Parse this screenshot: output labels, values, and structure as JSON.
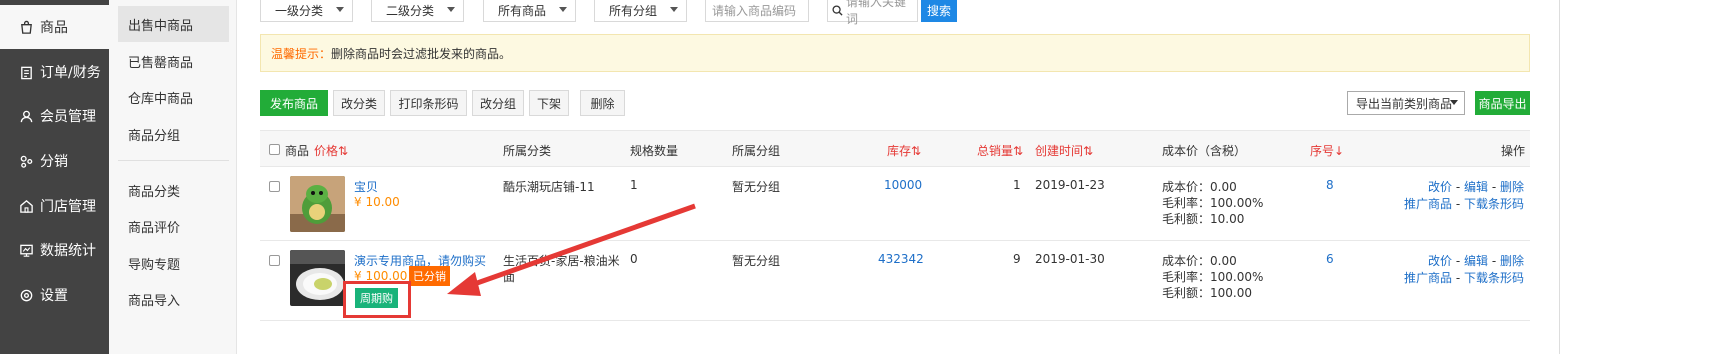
{
  "nav": {
    "items": [
      {
        "label": "商品",
        "icon": "bag-icon"
      },
      {
        "label": "订单/财务",
        "icon": "clipboard-icon"
      },
      {
        "label": "会员管理",
        "icon": "user-icon"
      },
      {
        "label": "分销",
        "icon": "share-icon"
      },
      {
        "label": "门店管理",
        "icon": "store-icon"
      },
      {
        "label": "数据统计",
        "icon": "monitor-icon"
      },
      {
        "label": "设置",
        "icon": "gear-icon"
      }
    ]
  },
  "subnav": {
    "items": [
      "出售中商品",
      "已售罄商品",
      "仓库中商品",
      "商品分组",
      "商品分类",
      "商品评价",
      "导购专题",
      "商品导入"
    ]
  },
  "filters": {
    "category1": "一级分类",
    "category2": "二级分类",
    "all_goods": "所有商品",
    "all_groups": "所有分组",
    "code_placeholder": "请输入商品编码",
    "keyword_placeholder": "请输入关键词",
    "search_label": "搜索"
  },
  "notice": {
    "lead": "温馨提示：",
    "text": "删除商品时会过滤批发来的商品。"
  },
  "toolbar": {
    "publish": "发布商品",
    "change_category": "改分类",
    "print_barcode": "打印条形码",
    "change_group": "改分组",
    "unlist": "下架",
    "delete": "删除",
    "export_select": "导出当前类别商品",
    "export_button": "商品导出"
  },
  "table": {
    "headers": {
      "goods": "商品",
      "price": "价格⇅",
      "category": "所属分类",
      "spec_count": "规格数量",
      "group": "所属分组",
      "stock": "库存⇅",
      "sales": "总销量⇅",
      "created": "创建时间⇅",
      "cost": "成本价（含税）",
      "seq": "序号↓",
      "ops": "操作"
    },
    "rows": [
      {
        "name": "宝贝",
        "price": "¥ 10.00",
        "category": "酷乐潮玩店铺-11",
        "spec_count": "1",
        "group": "暂无分组",
        "stock": "10000",
        "sales": "1",
        "created": "2019-01-23",
        "cost_lines": [
          "成本价：0.00",
          "毛利率：100.00%",
          "毛利额：10.00"
        ],
        "seq": "8",
        "ops_line1": [
          "改价",
          "编辑",
          "删除"
        ],
        "ops_line2": [
          "推广商品",
          "下载条形码"
        ]
      },
      {
        "name": "演示专用商品，请勿购买",
        "price": "¥ 100.00",
        "tag_distribution": "已分销",
        "tag_period": "周期购",
        "category_line1": "生活百货-家居-粮油米",
        "category_line2": "面",
        "spec_count": "0",
        "group": "暂无分组",
        "stock": "432342",
        "sales": "9",
        "created": "2019-01-30",
        "cost_lines": [
          "成本价：0.00",
          "毛利率：100.00%",
          "毛利额：100.00"
        ],
        "seq": "6",
        "ops_line1": [
          "改价",
          "编辑",
          "删除"
        ],
        "ops_line2": [
          "推广商品",
          "下载条形码"
        ]
      }
    ],
    "op_separator": " - "
  },
  "colors": {
    "nav_bg": "#434343",
    "primary_green": "#22ac38",
    "link_blue": "#1e6fc8",
    "accent_red": "#e53935",
    "price_orange": "#ff8c00"
  }
}
